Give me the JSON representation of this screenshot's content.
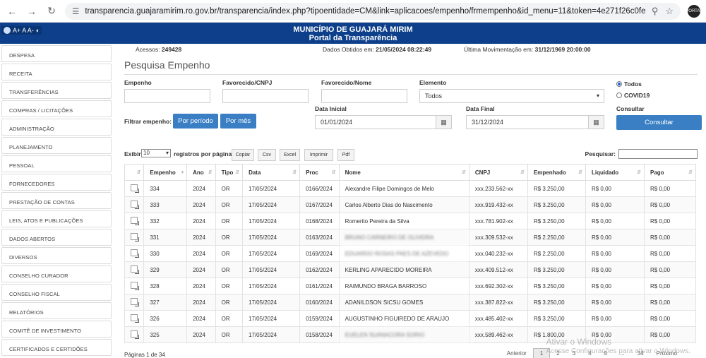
{
  "browser": {
    "url": "transparencia.guajaramirim.ro.gov.br/transparencia/index.php?tipoentidade=CM&link=aplicacoes/empenho/frmempenho&id_menu=11&token=4e271f26c0fe290b0e1f...",
    "profile_text": "PORTAL"
  },
  "header": {
    "access_text": "A+ A A-",
    "title_line1": "MUNICÍPIO DE GUAJARÁ MIRIM",
    "title_line2": "Portal da Transparência"
  },
  "sidebar": {
    "items": [
      "DESPESA",
      "RECEITA",
      "TRANSFERÊNCIAS",
      "COMPRAS / LICITAÇÕES",
      "ADMINISTRAÇÃO",
      "PLANEJAMENTO",
      "PESSOAL",
      "FORNECEDORES",
      "PRESTAÇÃO DE CONTAS",
      "LEIS, ATOS E PUBLICAÇÕES",
      "DADOS ABERTOS",
      "DIVERSOS",
      "CONSELHO CURADOR",
      "CONSELHO FISCAL",
      "RELATÓRIOS",
      "COMITÊ DE INVESTIMENTO",
      "CERTIFICADOS E CERTIDÕES"
    ]
  },
  "stats": {
    "acessos_label": "Acessos:",
    "acessos_value": "249428",
    "obtidos_label": "Dados Obtidos em:",
    "obtidos_value": "21/05/2024 08:22:49",
    "mov_label": "Última Movimentação em:",
    "mov_value": "31/12/1969 20:00:00"
  },
  "page_title": "Pesquisa Empenho",
  "filters": {
    "empenho_label": "Empenho",
    "favorecido_cnpj_label": "Favorecido/CNPJ",
    "favorecido_nome_label": "Favorecido/Nome",
    "elemento_label": "Elemento",
    "elemento_value": "Todos",
    "radio_todos": "Todos",
    "radio_covid": "COVID19",
    "filtrar_label": "Filtrar empenho:",
    "por_periodo": "Por período",
    "por_mes": "Por mês",
    "data_inicial_label": "Data Inicial",
    "data_inicial_value": "01/01/2024",
    "data_final_label": "Data Final",
    "data_final_value": "31/12/2024",
    "consultar_label": "Consultar",
    "consultar_button": "Consultar"
  },
  "tools": {
    "exibir": "Exibir",
    "length_value": "10",
    "registros": "registros por página",
    "copiar": "Copiar",
    "csv": "Csv",
    "excel": "Excel",
    "imprimir": "Imprimir",
    "pdf": "Pdf",
    "pesquisar": "Pesquisar:"
  },
  "table": {
    "headers": [
      "",
      "Empenho",
      "Ano",
      "Tipo",
      "Data",
      "Proc",
      "Nome",
      "CNPJ",
      "Empenhado",
      "Liquidado",
      "Pago"
    ],
    "rows": [
      {
        "empenho": "334",
        "ano": "2024",
        "tipo": "OR",
        "data": "17/05/2024",
        "proc": "0166/2024",
        "nome": "Alexandre Filipe Domingos de Melo",
        "blur": false,
        "cnpj": "xxx.233.562-xx",
        "empenhado": "R$ 3.250,00",
        "liquidado": "R$ 0,00",
        "pago": "R$ 0,00"
      },
      {
        "empenho": "333",
        "ano": "2024",
        "tipo": "OR",
        "data": "17/05/2024",
        "proc": "0167/2024",
        "nome": "Carlos Alberto Dias do Nascimento",
        "blur": false,
        "cnpj": "xxx.919.432-xx",
        "empenhado": "R$ 3.250,00",
        "liquidado": "R$ 0,00",
        "pago": "R$ 0,00"
      },
      {
        "empenho": "332",
        "ano": "2024",
        "tipo": "OR",
        "data": "17/05/2024",
        "proc": "0168/2024",
        "nome": "Romerito Pereira da Silva",
        "blur": false,
        "cnpj": "xxx.781.902-xx",
        "empenhado": "R$ 3.250,00",
        "liquidado": "R$ 0,00",
        "pago": "R$ 0,00"
      },
      {
        "empenho": "331",
        "ano": "2024",
        "tipo": "OR",
        "data": "17/05/2024",
        "proc": "0163/2024",
        "nome": "BRUNO CARNEIRO DE OLIVEIRA",
        "blur": true,
        "cnpj": "xxx.309.532-xx",
        "empenhado": "R$ 2.250,00",
        "liquidado": "R$ 0,00",
        "pago": "R$ 0,00"
      },
      {
        "empenho": "330",
        "ano": "2024",
        "tipo": "OR",
        "data": "17/05/2024",
        "proc": "0169/2024",
        "nome": "EDUARDO ROSAS PAES DE AZEVEDO",
        "blur": true,
        "cnpj": "xxx.040.232-xx",
        "empenhado": "R$ 2.250,00",
        "liquidado": "R$ 0,00",
        "pago": "R$ 0,00"
      },
      {
        "empenho": "329",
        "ano": "2024",
        "tipo": "OR",
        "data": "17/05/2024",
        "proc": "0162/2024",
        "nome": "KERLING APARECIDO MOREIRA",
        "blur": false,
        "cnpj": "xxx.409.512-xx",
        "empenhado": "R$ 3.250,00",
        "liquidado": "R$ 0,00",
        "pago": "R$ 0,00"
      },
      {
        "empenho": "328",
        "ano": "2024",
        "tipo": "OR",
        "data": "17/05/2024",
        "proc": "0161/2024",
        "nome": "RAIMUNDO BRAGA BARROSO",
        "blur": false,
        "cnpj": "xxx.692.302-xx",
        "empenhado": "R$ 3.250,00",
        "liquidado": "R$ 0,00",
        "pago": "R$ 0,00"
      },
      {
        "empenho": "327",
        "ano": "2024",
        "tipo": "OR",
        "data": "17/05/2024",
        "proc": "0160/2024",
        "nome": "ADANILDSON SICSU GOMES",
        "blur": false,
        "cnpj": "xxx.387.822-xx",
        "empenhado": "R$ 3.250,00",
        "liquidado": "R$ 0,00",
        "pago": "R$ 0,00"
      },
      {
        "empenho": "326",
        "ano": "2024",
        "tipo": "OR",
        "data": "17/05/2024",
        "proc": "0159/2024",
        "nome": "AUGUSTINHO FIGUIREDO DE ARAUJO",
        "blur": false,
        "cnpj": "xxx.485.402-xx",
        "empenhado": "R$ 3.250,00",
        "liquidado": "R$ 0,00",
        "pago": "R$ 0,00"
      },
      {
        "empenho": "325",
        "ano": "2024",
        "tipo": "OR",
        "data": "17/05/2024",
        "proc": "0158/2024",
        "nome": "EUELEN SUANACORA SORIO",
        "blur": true,
        "cnpj": "xxx.589.462-xx",
        "empenhado": "R$ 1.800,00",
        "liquidado": "R$ 0,00",
        "pago": "R$ 0,00"
      }
    ]
  },
  "footer": {
    "pages_info": "Páginas 1 de 34",
    "anterior": "Anterior",
    "pages": [
      "1",
      "2",
      "3",
      "4",
      "5",
      "...",
      "34"
    ],
    "proximo": "Próximo",
    "watermark1": "Ativar o Windows",
    "watermark2": "Acesse Configurações para ativar o Windows."
  }
}
